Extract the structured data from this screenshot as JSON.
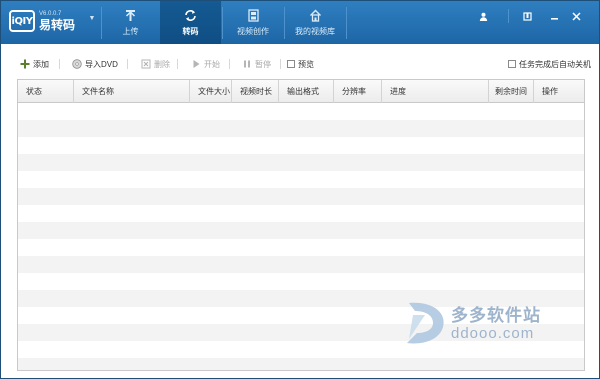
{
  "app": {
    "version": "V6.0.0.7",
    "name": "易转码",
    "logo_badge": "iQIY",
    "dropdown_icon": "triangle-down-icon"
  },
  "tabs": [
    {
      "label": "上传",
      "icon": "upload-icon",
      "active": false
    },
    {
      "label": "转码",
      "icon": "convert-icon",
      "active": true
    },
    {
      "label": "视频创作",
      "icon": "film-icon",
      "active": false
    },
    {
      "label": "我的视频库",
      "icon": "home-icon",
      "active": false
    }
  ],
  "window_buttons": {
    "user": "user-icon",
    "skin": "skin-icon",
    "minimize": "minimize-icon",
    "close": "close-icon"
  },
  "toolbar": {
    "add": "添加",
    "import_dvd": "导入DVD",
    "delete": "删除",
    "start": "开始",
    "pause": "暂停",
    "preview": "预览",
    "auto_shutdown": "任务完成后自动关机"
  },
  "table": {
    "columns": [
      "状态",
      "文件名称",
      "文件大小",
      "视频时长",
      "输出格式",
      "分辨率",
      "进度",
      "剩余时间",
      "操作"
    ],
    "rows": []
  },
  "watermark": {
    "title": "多多软件站",
    "url": "ddooo.com"
  },
  "colors": {
    "titlebar": "#2573b5",
    "active_tab": "#125489",
    "row_alt": "#f3f3f3"
  }
}
